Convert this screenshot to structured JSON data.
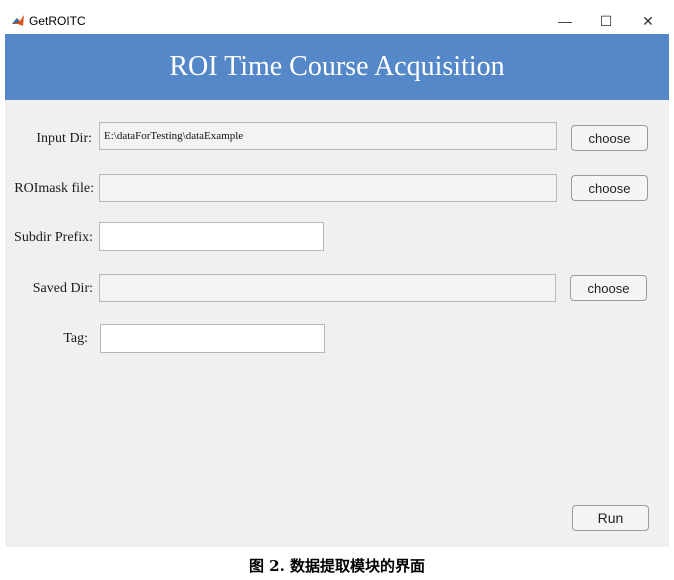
{
  "window": {
    "title": "GetROITC",
    "minimize_glyph": "—",
    "maximize_glyph": "☐",
    "close_glyph": "✕"
  },
  "banner": {
    "title": "ROI Time Course Acquisition",
    "color": "#5588c9"
  },
  "form": {
    "input_dir": {
      "label": "Input Dir:",
      "value": "E:\\dataForTesting\\dataExample",
      "button": "choose"
    },
    "roimask_file": {
      "label": "ROImask file:",
      "value": "",
      "button": "choose"
    },
    "subdir_prefix": {
      "label": "Subdir Prefix:",
      "value": ""
    },
    "saved_dir": {
      "label": "Saved Dir:",
      "value": "",
      "button": "choose"
    },
    "tag": {
      "label": "Tag:",
      "value": ""
    }
  },
  "run_button": "Run",
  "caption": "图 2.  数据提取模块的界面"
}
